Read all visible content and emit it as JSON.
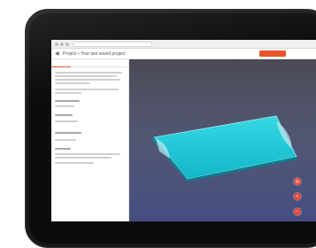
{
  "app": {
    "title": "Project • Your last saved project",
    "brand_badge": "",
    "brand_text": ""
  },
  "left_panel": {
    "tabs": [
      "",
      "",
      "",
      ""
    ]
  },
  "icons": {
    "back": "back-arrow-icon",
    "view_reset": "target-icon",
    "zoom_in": "plus-icon",
    "zoom_out": "minus-icon",
    "help": "question-icon"
  },
  "colors": {
    "accent": "#e8542b",
    "fab": "#e74c3c",
    "floor_cyan": "#1fc6d6",
    "viewport_bg": "#55555f"
  }
}
